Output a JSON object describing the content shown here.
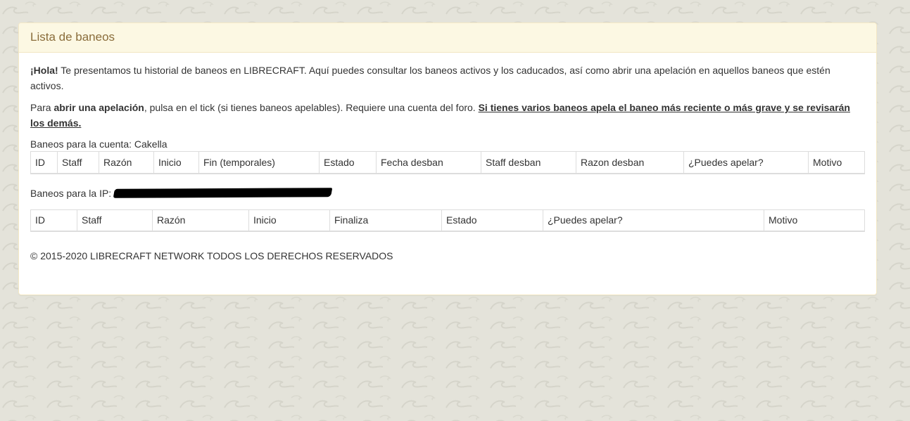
{
  "panel": {
    "title": "Lista de baneos"
  },
  "intro": {
    "greeting": "¡Hola!",
    "text": " Te presentamos tu historial de baneos en LIBRECRAFT. Aquí puedes consultar los baneos activos y los caducados, así como abrir una apelación en aquellos baneos que estén activos."
  },
  "appeal": {
    "prefix": "Para ",
    "bold": "abrir una apelación",
    "middle": ", pulsa en el tick (si tienes baneos apelables). Requiere una cuenta del foro. ",
    "underlined": "Si tienes varios baneos apela el baneo más reciente o más grave y se revisarán los demás."
  },
  "account_section": {
    "label": "Baneos para la cuenta: Cakella",
    "columns": [
      "ID",
      "Staff",
      "Razón",
      "Inicio",
      "Fin (temporales)",
      "Estado",
      "Fecha desban",
      "Staff desban",
      "Razon desban",
      "¿Puedes apelar?",
      "Motivo"
    ]
  },
  "ip_section": {
    "label": "Baneos para la IP:",
    "columns": [
      "ID",
      "Staff",
      "Razón",
      "Inicio",
      "Finaliza",
      "Estado",
      "¿Puedes apelar?",
      "Motivo"
    ]
  },
  "footer": {
    "copyright": "© 2015-2020 LIBRECRAFT NETWORK TODOS LOS DERECHOS RESERVADOS"
  },
  "colors": {
    "background": "#e4e3da",
    "heading_bg": "#fcf8e3",
    "heading_text": "#8a6d3b",
    "text": "#333333",
    "border": "#dddddd"
  }
}
